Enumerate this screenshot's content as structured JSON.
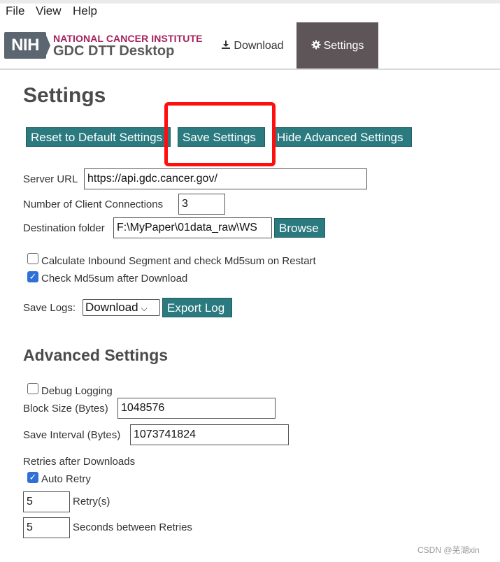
{
  "menu": {
    "file": "File",
    "view": "View",
    "help": "Help"
  },
  "header": {
    "logo_text": "NIH",
    "institute": "NATIONAL CANCER INSTITUTE",
    "app_name": "GDC DTT Desktop",
    "nav_download": "Download",
    "nav_settings": "Settings"
  },
  "page": {
    "title": "Settings",
    "buttons": {
      "reset": "Reset to Default Settings",
      "save": "Save Settings",
      "hide_advanced": "Hide Advanced Settings",
      "browse": "Browse",
      "export_log": "Export Log"
    },
    "server_url_label": "Server URL",
    "server_url_value": "https://api.gdc.cancer.gov/",
    "connections_label": "Number of Client Connections",
    "connections_value": "3",
    "destination_label": "Destination folder",
    "destination_value": "F:\\MyPaper\\01data_raw\\WS",
    "calc_inbound_label": "Calculate Inbound Segment and check Md5sum on Restart",
    "calc_inbound_checked": false,
    "check_md5_label": "Check Md5sum after Download",
    "check_md5_checked": true,
    "save_logs_label": "Save Logs:",
    "save_logs_selected": "Download"
  },
  "advanced": {
    "title": "Advanced Settings",
    "debug_label": "Debug Logging",
    "debug_checked": false,
    "block_size_label": "Block Size (Bytes)",
    "block_size_value": "1048576",
    "save_interval_label": "Save Interval (Bytes)",
    "save_interval_value": "1073741824",
    "retries_heading": "Retries after Downloads",
    "auto_retry_label": "Auto Retry",
    "auto_retry_checked": true,
    "retry_count_value": "5",
    "retry_count_label": "Retry(s)",
    "retry_seconds_value": "5",
    "retry_seconds_label": "Seconds between Retries"
  },
  "watermark": "CSDN @芜湖xin",
  "colors": {
    "button": "#2b7a7f",
    "nav_active": "#5e5558",
    "highlight": "#ff0e0e",
    "institute": "#a5215c"
  }
}
